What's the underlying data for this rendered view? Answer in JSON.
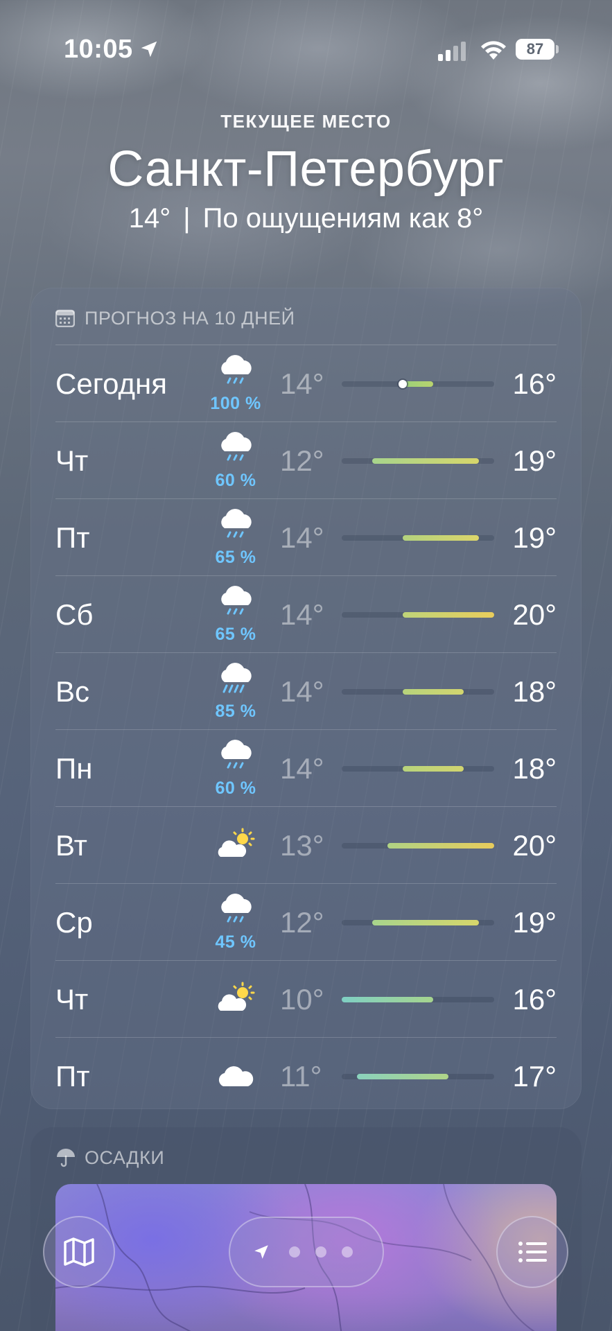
{
  "status_bar": {
    "time": "10:05",
    "battery": "87"
  },
  "header": {
    "location_label": "ТЕКУЩЕЕ МЕСТО",
    "city": "Санкт-Петербург",
    "current_temp": "14°",
    "separator": "|",
    "feels_like": "По ощущениям как 8°"
  },
  "forecast": {
    "title": "ПРОГНОЗ НА 10 ДНЕЙ",
    "range_min": 10,
    "range_max": 20,
    "current_temp_value": 14,
    "days": [
      {
        "day": "Сегодня",
        "icon": "cloud-rain-icon",
        "precip": "100 %",
        "min": "14°",
        "max": "16°",
        "min_v": 14,
        "max_v": 16,
        "color_from": "#9ad07a",
        "color_to": "#b9d36e",
        "current": true
      },
      {
        "day": "Чт",
        "icon": "cloud-rain-icon",
        "precip": "60 %",
        "min": "12°",
        "max": "19°",
        "min_v": 12,
        "max_v": 19,
        "color_from": "#a8d48c",
        "color_to": "#d7d66b"
      },
      {
        "day": "Пт",
        "icon": "cloud-rain-icon",
        "precip": "65 %",
        "min": "14°",
        "max": "19°",
        "min_v": 14,
        "max_v": 19,
        "color_from": "#b3d27e",
        "color_to": "#dcd56a"
      },
      {
        "day": "Сб",
        "icon": "cloud-rain-icon",
        "precip": "65 %",
        "min": "14°",
        "max": "20°",
        "min_v": 14,
        "max_v": 20,
        "color_from": "#bfd479",
        "color_to": "#e9cd5c"
      },
      {
        "day": "Вс",
        "icon": "cloud-heavy-rain-icon",
        "precip": "85 %",
        "min": "14°",
        "max": "18°",
        "min_v": 14,
        "max_v": 18,
        "color_from": "#b7d37c",
        "color_to": "#d2d56f"
      },
      {
        "day": "Пн",
        "icon": "cloud-rain-icon",
        "precip": "60 %",
        "min": "14°",
        "max": "18°",
        "min_v": 14,
        "max_v": 18,
        "color_from": "#b7d37c",
        "color_to": "#d2d56f"
      },
      {
        "day": "Вт",
        "icon": "partly-sunny-icon",
        "precip": "",
        "min": "13°",
        "max": "20°",
        "min_v": 13,
        "max_v": 20,
        "color_from": "#b0d384",
        "color_to": "#e8cc5c"
      },
      {
        "day": "Ср",
        "icon": "cloud-rain-icon",
        "precip": "45 %",
        "min": "12°",
        "max": "19°",
        "min_v": 12,
        "max_v": 19,
        "color_from": "#a8d48c",
        "color_to": "#d7d66b"
      },
      {
        "day": "Чт",
        "icon": "partly-sunny-icon",
        "precip": "",
        "min": "10°",
        "max": "16°",
        "min_v": 10,
        "max_v": 16,
        "color_from": "#7fd0c4",
        "color_to": "#a6d48e"
      },
      {
        "day": "Пт",
        "icon": "cloud-icon",
        "precip": "",
        "min": "11°",
        "max": "17°",
        "min_v": 11,
        "max_v": 17,
        "color_from": "#8ad2bd",
        "color_to": "#b0d488"
      }
    ]
  },
  "precip_card": {
    "title": "ОСАДКИ"
  },
  "toolbar": {
    "map_button": "map-icon",
    "list_button": "list-icon",
    "page_dots": 3
  }
}
